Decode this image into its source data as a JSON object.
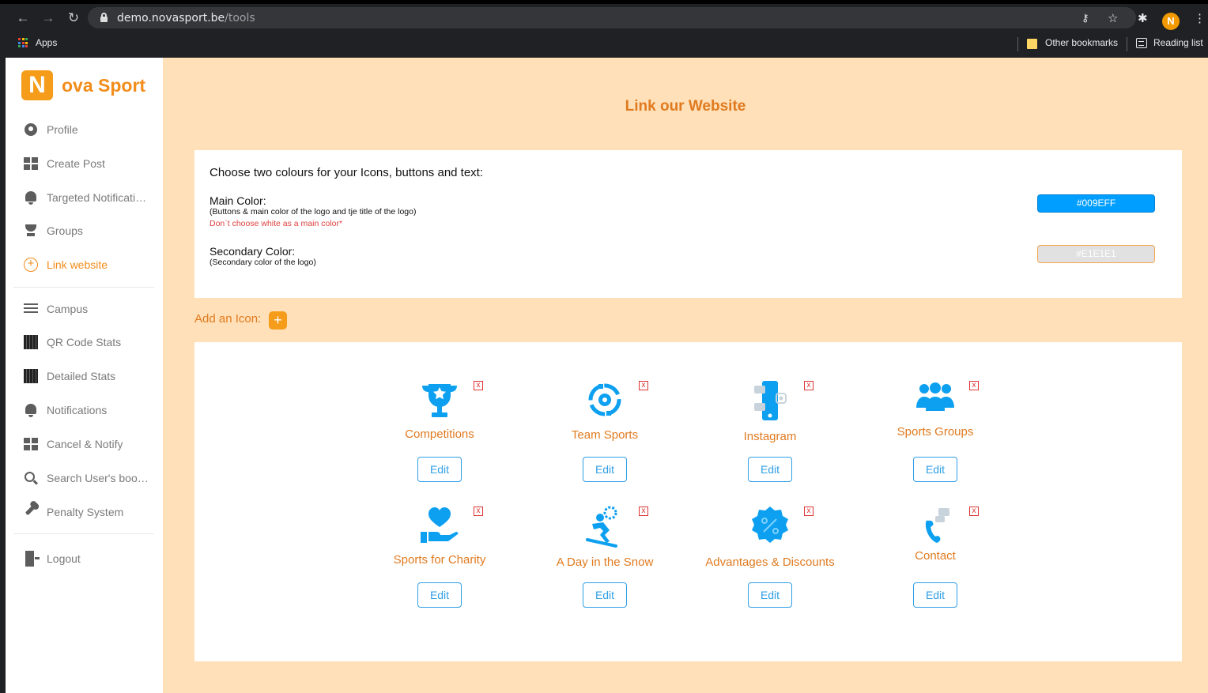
{
  "browser": {
    "url_host": "demo.novasport.be",
    "url_path": "/tools",
    "profile_initial": "N",
    "bookmarks": {
      "apps": "Apps",
      "other": "Other bookmarks",
      "reading": "Reading list"
    }
  },
  "sidebar": {
    "logo_letter": "N",
    "logo_text": "ova Sport",
    "items": [
      {
        "label": "Profile",
        "icon": "profile-icon"
      },
      {
        "label": "Create Post",
        "icon": "grid-icon"
      },
      {
        "label": "Targeted Notifications",
        "icon": "bell-icon"
      },
      {
        "label": "Groups",
        "icon": "trophy-icon"
      },
      {
        "label": "Link website",
        "icon": "add-circle-icon",
        "active": true
      },
      {
        "label": "Campus",
        "icon": "list-icon"
      },
      {
        "label": "QR Code Stats",
        "icon": "qr-icon"
      },
      {
        "label": "Detailed Stats",
        "icon": "qr-icon"
      },
      {
        "label": "Notifications",
        "icon": "bell-icon"
      },
      {
        "label": "Cancel & Notify",
        "icon": "grid-icon"
      },
      {
        "label": "Search User's bookings",
        "icon": "search-icon"
      },
      {
        "label": "Penalty System",
        "icon": "wrench-icon"
      },
      {
        "label": "Logout",
        "icon": "logout-icon"
      }
    ]
  },
  "main": {
    "title": "Link our Website",
    "colors_panel": {
      "heading": "Choose two colours for your Icons, buttons and text:",
      "main_label": "Main Color:",
      "main_sub": "(Buttons & main color of the logo and tje title of the logo)",
      "main_warning": "Don`t choose white as a main color*",
      "main_value": "#009EFF",
      "secondary_label": "Secondary Color:",
      "secondary_sub": "(Secondary color of the logo)",
      "secondary_value": "#E1E1E1"
    },
    "add_icon_label": "Add an Icon:",
    "add_icon_button": "+",
    "icons": [
      {
        "label": "Competitions",
        "icon": "trophy-icon",
        "edit": "Edit",
        "remove": "x"
      },
      {
        "label": "Team Sports",
        "icon": "team-cycle-icon",
        "edit": "Edit",
        "remove": "x"
      },
      {
        "label": "Instagram",
        "icon": "phone-social-icon",
        "edit": "Edit",
        "remove": "x"
      },
      {
        "label": "Sports Groups",
        "icon": "group-icon",
        "edit": "Edit",
        "remove": "x"
      },
      {
        "label": "Sports for Charity",
        "icon": "heart-hand-icon",
        "edit": "Edit",
        "remove": "x"
      },
      {
        "label": "A Day in the Snow",
        "icon": "skier-icon",
        "edit": "Edit",
        "remove": "x"
      },
      {
        "label": "Advantages & Discounts",
        "icon": "discount-badge-icon",
        "edit": "Edit",
        "remove": "x"
      },
      {
        "label": "Contact",
        "icon": "contact-phone-icon",
        "edit": "Edit",
        "remove": "x"
      }
    ],
    "accent_color": "#009EFF",
    "brand_color": "#F28C1A"
  }
}
